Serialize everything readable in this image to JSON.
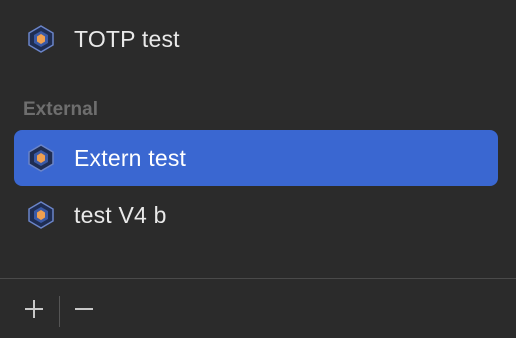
{
  "list": {
    "items": [
      {
        "label": "TOTP test",
        "icon": "keychain-icon",
        "selected": false
      },
      {
        "label": "Extern test",
        "icon": "keychain-icon",
        "selected": true
      },
      {
        "label": "test V4 b",
        "icon": "keychain-icon",
        "selected": false
      }
    ],
    "section_external": "External"
  },
  "toolbar": {
    "add_label": "+",
    "remove_label": "−"
  },
  "colors": {
    "background": "#2b2b2b",
    "selection": "#3a67d1",
    "icon_outer": "#2a3a66",
    "icon_inner": "#f0a050"
  }
}
